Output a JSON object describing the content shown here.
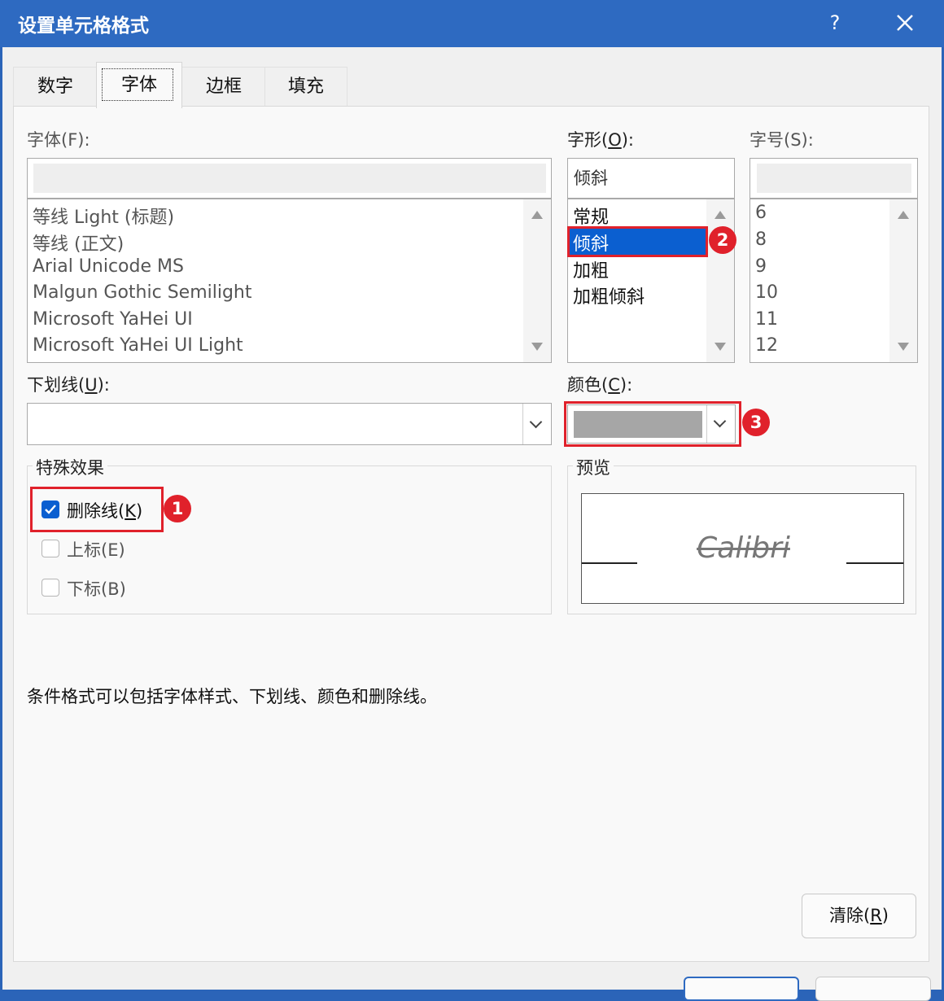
{
  "window": {
    "title": "设置单元格格式",
    "help": "?"
  },
  "tabs": [
    "数字",
    "字体",
    "边框",
    "填充"
  ],
  "font": {
    "label_pre": "字体(",
    "label_key": "F",
    "label_post": "):",
    "input_value": "",
    "items": [
      "等线 Light (标题)",
      "等线 (正文)",
      "Arial Unicode MS",
      "Malgun Gothic Semilight",
      "Microsoft YaHei UI",
      "Microsoft YaHei UI Light"
    ]
  },
  "style": {
    "label_pre": "字形(",
    "label_key": "O",
    "label_post": "):",
    "input_value": "倾斜",
    "items": [
      "常规",
      "倾斜",
      "加粗",
      "加粗倾斜"
    ],
    "selected": "倾斜"
  },
  "size": {
    "label_pre": "字号(",
    "label_key": "S",
    "label_post": "):",
    "input_value": "",
    "items": [
      "6",
      "8",
      "9",
      "10",
      "11",
      "12"
    ]
  },
  "underline": {
    "label_pre": "下划线(",
    "label_key": "U",
    "label_post": "):",
    "value": ""
  },
  "color": {
    "label_pre": "颜色(",
    "label_key": "C",
    "label_post": "):",
    "swatch": "#a6a6a6"
  },
  "effects": {
    "title": "特殊效果",
    "strikethrough": {
      "label_pre": "删除线(",
      "label_key": "K",
      "label_post": ")",
      "checked": true
    },
    "superscript": {
      "label": "上标(E)",
      "checked": false
    },
    "subscript": {
      "label": "下标(B)",
      "checked": false
    }
  },
  "preview": {
    "title": "预览",
    "sample": "Calibri"
  },
  "note": "条件格式可以包括字体样式、下划线、颜色和删除线。",
  "clear_button": {
    "label_pre": "清除(",
    "label_key": "R",
    "label_post": ")"
  },
  "annotations": [
    "1",
    "2",
    "3"
  ],
  "colors": {
    "accent": "#0b5fd0",
    "highlight": "#e0212b",
    "titlebar": "#2e6ac1"
  }
}
